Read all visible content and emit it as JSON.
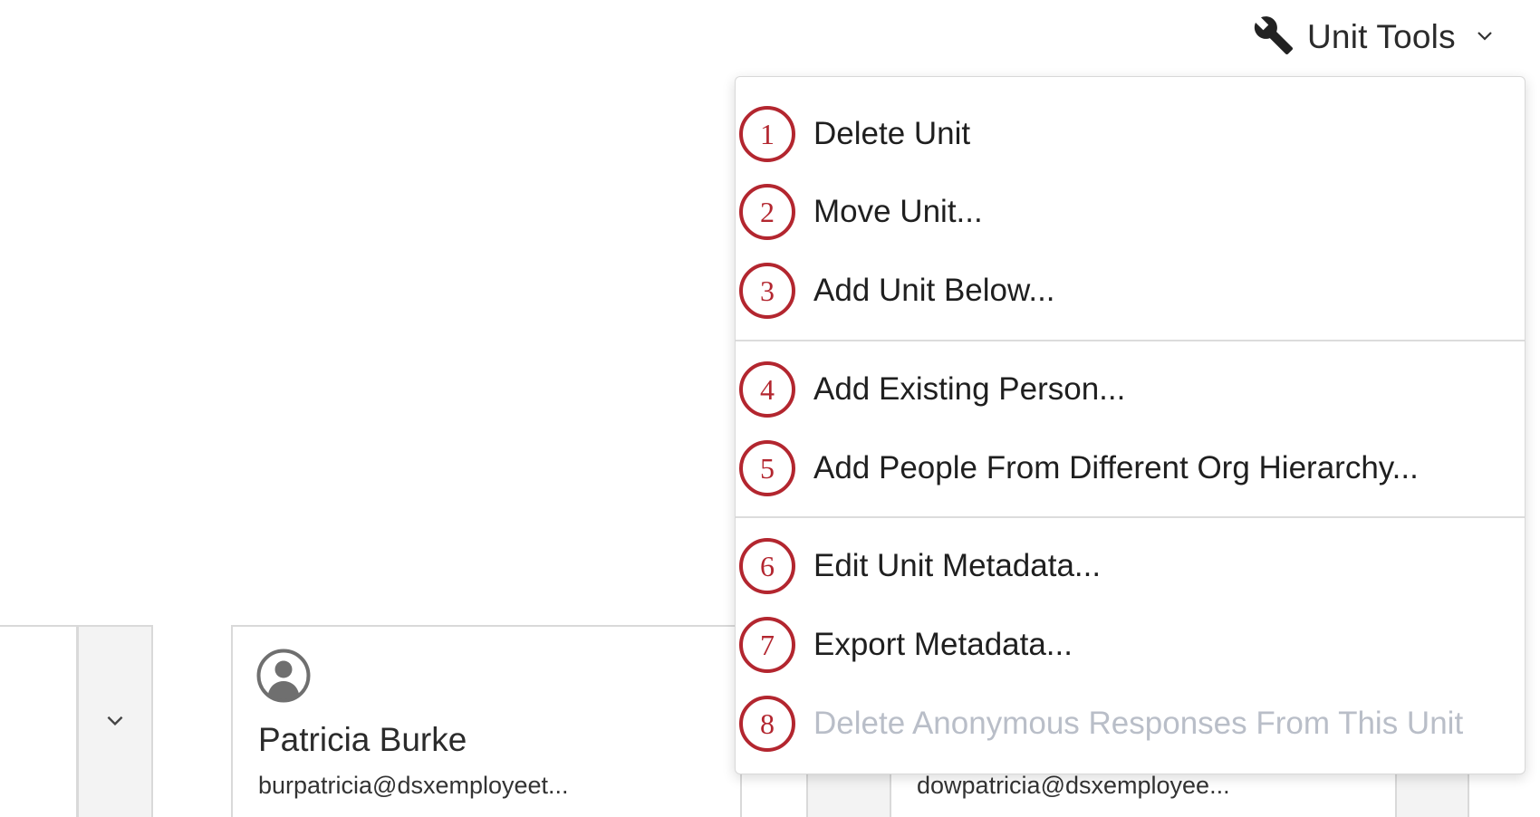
{
  "header": {
    "unit_tools_label": "Unit Tools"
  },
  "menu": {
    "items": [
      {
        "num": "1",
        "label": "Delete Unit",
        "enabled": true
      },
      {
        "num": "2",
        "label": "Move Unit...",
        "enabled": true
      },
      {
        "num": "3",
        "label": "Add Unit Below...",
        "enabled": true
      },
      {
        "num": "4",
        "label": "Add Existing Person...",
        "enabled": true
      },
      {
        "num": "5",
        "label": "Add People From Different Org Hierarchy...",
        "enabled": true
      },
      {
        "num": "6",
        "label": "Edit Unit Metadata...",
        "enabled": true
      },
      {
        "num": "7",
        "label": "Export Metadata...",
        "enabled": true
      },
      {
        "num": "8",
        "label": "Delete Anonymous Responses From This Unit",
        "enabled": false
      }
    ]
  },
  "cards": {
    "main": {
      "name": "Patricia Burke",
      "email": "burpatricia@dsxemployeet..."
    },
    "right": {
      "email": "dowpatricia@dsxemployee..."
    }
  },
  "colors": {
    "annotation_red": "#b3262f",
    "disabled_text": "#b9bec8"
  },
  "icons": {
    "unit_tools": "wrench-icon",
    "dropdown": "chevron-down-icon",
    "avatar": "user-avatar-icon"
  }
}
